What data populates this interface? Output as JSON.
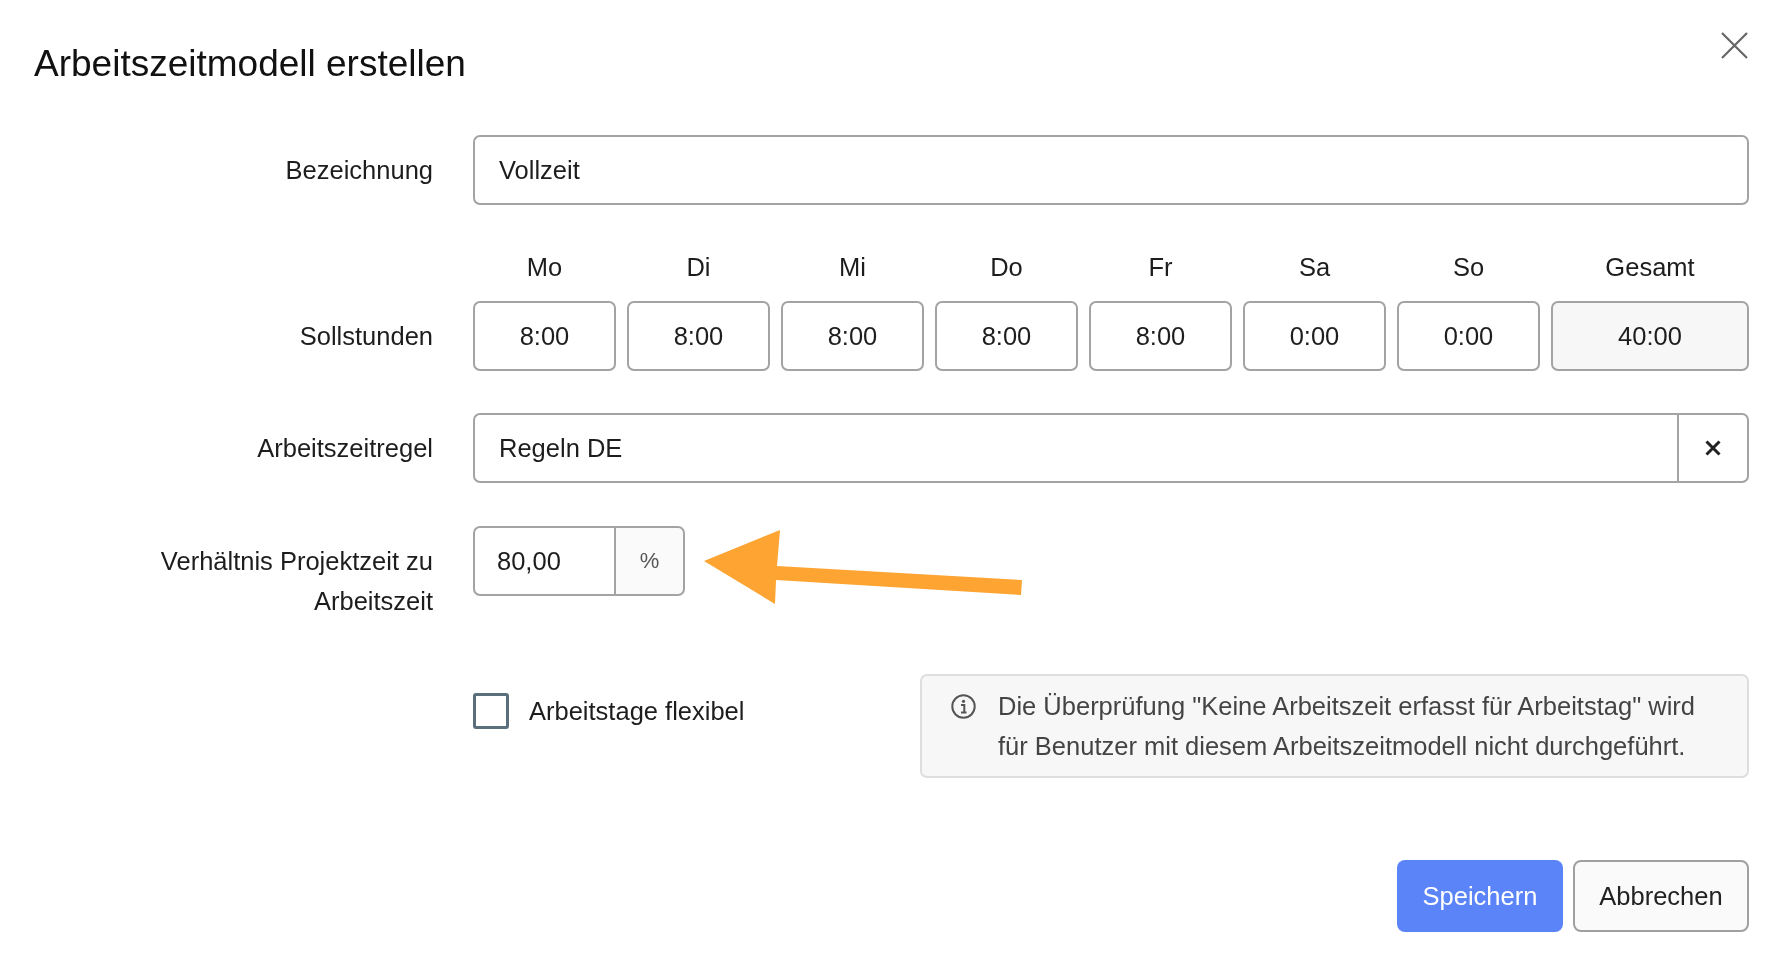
{
  "title": "Arbeitszeitmodell erstellen",
  "name_field": {
    "label": "Bezeichnung",
    "value": "Vollzeit"
  },
  "target_hours": {
    "label": "Sollstunden",
    "days": [
      {
        "day": "Mo",
        "value": "8:00"
      },
      {
        "day": "Di",
        "value": "8:00"
      },
      {
        "day": "Mi",
        "value": "8:00"
      },
      {
        "day": "Do",
        "value": "8:00"
      },
      {
        "day": "Fr",
        "value": "8:00"
      },
      {
        "day": "Sa",
        "value": "0:00"
      },
      {
        "day": "So",
        "value": "0:00"
      }
    ],
    "total": {
      "label": "Gesamt",
      "value": "40:00"
    }
  },
  "rule_field": {
    "label": "Arbeitszeitregel",
    "value": "Regeln DE"
  },
  "ratio_field": {
    "label": "Verhältnis Projektzeit zu Arbeitszeit",
    "value": "80,00",
    "unit": "%"
  },
  "flexible_days": {
    "label": "Arbeitstage flexibel",
    "checked": false
  },
  "info_note": "Die Überprüfung \"Keine Arbeitszeit erfasst für Arbeitstag\" wird für Benutzer mit diesem Arbeitszeitmodell nicht durchgeführt.",
  "buttons": [
    {
      "label": "Speichern",
      "kind": "primary"
    },
    {
      "label": "Abbrechen",
      "kind": "secondary"
    }
  ]
}
